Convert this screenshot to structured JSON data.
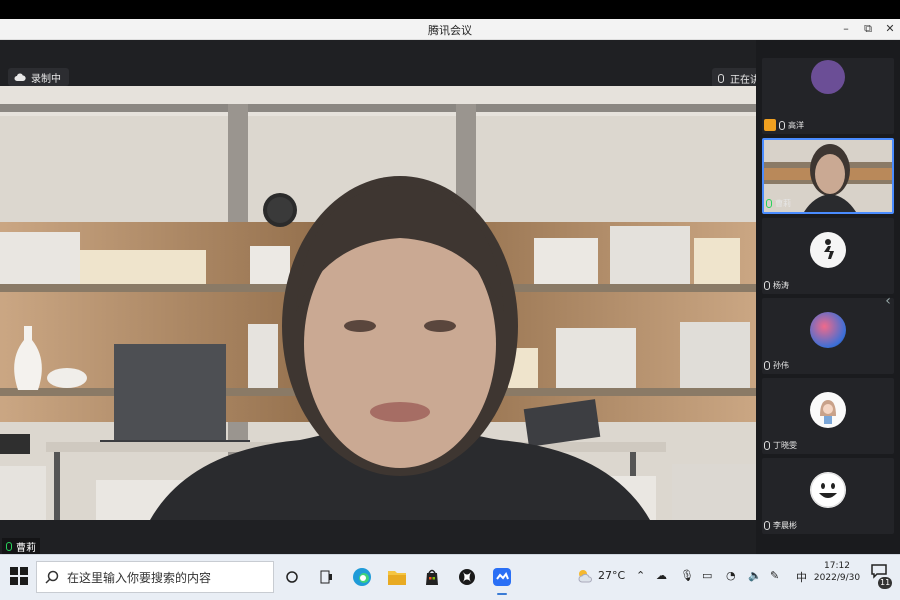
{
  "window": {
    "title": "腾讯会议",
    "minimize": "–",
    "maximize": "⧉",
    "close": "✕"
  },
  "meeting": {
    "recording_label": "录制中",
    "speaking_label": "正在讲话: 曹莉",
    "main_speaker_name": "曹莉"
  },
  "participants": [
    {
      "name": "高洋",
      "mic_color": "#dddddd",
      "kind": "avatar",
      "badge": true
    },
    {
      "name": "曹莉",
      "mic_color": "#28d35c",
      "kind": "video",
      "active": true
    },
    {
      "name": "杨涛",
      "mic_color": "#dddddd",
      "kind": "avatar"
    },
    {
      "name": "孙伟",
      "mic_color": "#dddddd",
      "kind": "avatar"
    },
    {
      "name": "丁晓雯",
      "mic_color": "#dddddd",
      "kind": "avatar"
    },
    {
      "name": "李晨彬",
      "mic_color": "#dddddd",
      "kind": "avatar"
    }
  ],
  "taskbar": {
    "search_placeholder": "在这里输入你要搜索的内容",
    "weather": "27°C",
    "ime": "中",
    "time": "17:12",
    "date": "2022/9/30",
    "notification_count": "11"
  },
  "colors": {
    "accent": "#4a8cff",
    "mic_active": "#28d35c",
    "main_bg": "#1e1f22"
  }
}
